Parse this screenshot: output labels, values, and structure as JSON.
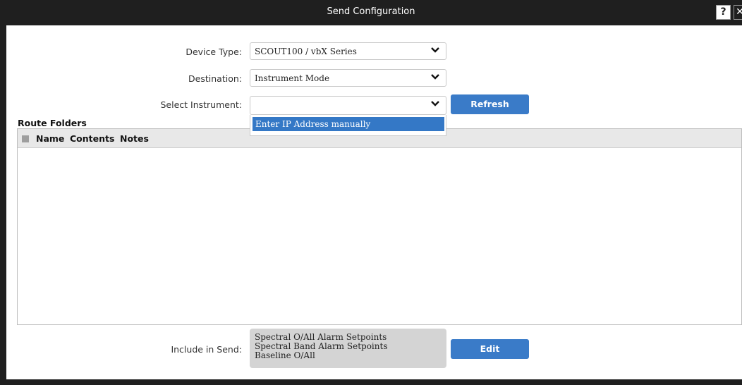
{
  "window": {
    "title": "Send Configuration",
    "help_label": "?",
    "close_label": "✕"
  },
  "form": {
    "device_type": {
      "label": "Device Type:",
      "value": "SCOUT100 / vbX Series"
    },
    "destination": {
      "label": "Destination:",
      "value": "Instrument Mode"
    },
    "select_instrument": {
      "label": "Select Instrument:",
      "value": "",
      "options": [
        "Enter IP Address manually"
      ]
    },
    "refresh_label": "Refresh"
  },
  "route_folders": {
    "title": "Route Folders",
    "columns": [
      "Name",
      "Contents",
      "Notes"
    ]
  },
  "include_in_send": {
    "label": "Include in Send:",
    "items": [
      "Spectral O/All Alarm Setpoints",
      "Spectral Band Alarm Setpoints",
      "Baseline O/All"
    ],
    "edit_label": "Edit"
  }
}
